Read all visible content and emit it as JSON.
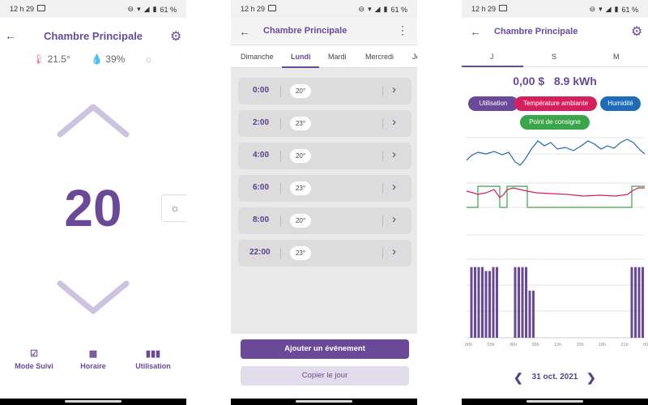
{
  "status": {
    "time": "12 h 29",
    "battery": "61 %"
  },
  "screen1": {
    "title": "Chambre Principale",
    "temperature": "21.5°",
    "humidity": "39%",
    "setpoint": "20",
    "nav": [
      {
        "label": "Mode Suivi"
      },
      {
        "label": "Horaire"
      },
      {
        "label": "Utilisation"
      }
    ]
  },
  "screen2": {
    "title": "Chambre Principale",
    "tabs": [
      "Dimanche",
      "Lundi",
      "Mardi",
      "Mercredi",
      "Je"
    ],
    "active_tab": "Lundi",
    "events": [
      {
        "time": "0:00",
        "temp": "20°"
      },
      {
        "time": "2:00",
        "temp": "23°"
      },
      {
        "time": "4:00",
        "temp": "20°"
      },
      {
        "time": "6:00",
        "temp": "23°"
      },
      {
        "time": "8:00",
        "temp": "20°"
      },
      {
        "time": "22:00",
        "temp": "23°"
      }
    ],
    "add_button": "Ajouter un événement",
    "copy_button": "Copier le jour"
  },
  "screen3": {
    "title": "Chambre Principale",
    "tabs": [
      "J",
      "S",
      "M"
    ],
    "cost": "0,00 $",
    "energy": "8.9 kWh",
    "chips": [
      {
        "label": "Utilisation",
        "color": "#6a4a98"
      },
      {
        "label": "Température ambiante",
        "color": "#d6205e"
      },
      {
        "label": "Humidité",
        "color": "#1e6bb8"
      },
      {
        "label": "Point de consigne",
        "color": "#3aa54a"
      }
    ],
    "xticks": [
      "00h",
      "03h",
      "06h",
      "09h",
      "12h",
      "15h",
      "18h",
      "21h",
      "00h"
    ],
    "date": "31 oct. 2021"
  },
  "chart_data": {
    "type": "bar",
    "categories": [
      "00h",
      "01h",
      "02h",
      "03h",
      "04h",
      "05h",
      "06h",
      "07h",
      "08h",
      "09h",
      "10h",
      "11h",
      "12h",
      "13h",
      "14h",
      "15h",
      "16h",
      "17h",
      "18h",
      "19h",
      "20h",
      "21h",
      "22h",
      "23h"
    ],
    "values": [
      0.9,
      0.9,
      0.85,
      0.9,
      0.0,
      0.0,
      0.9,
      0.9,
      0.6,
      0.0,
      0.0,
      0.0,
      0.0,
      0.0,
      0.0,
      0.0,
      0.0,
      0.0,
      0.0,
      0.0,
      0.0,
      0.0,
      0.9,
      0.9
    ],
    "title": "",
    "xlabel": "",
    "ylabel": "",
    "grid": true,
    "colors": {
      "usage": "#6a4a98",
      "temperature": "#d6205e",
      "humidity": "#1e6bb8",
      "setpoint": "#3aa54a"
    }
  }
}
